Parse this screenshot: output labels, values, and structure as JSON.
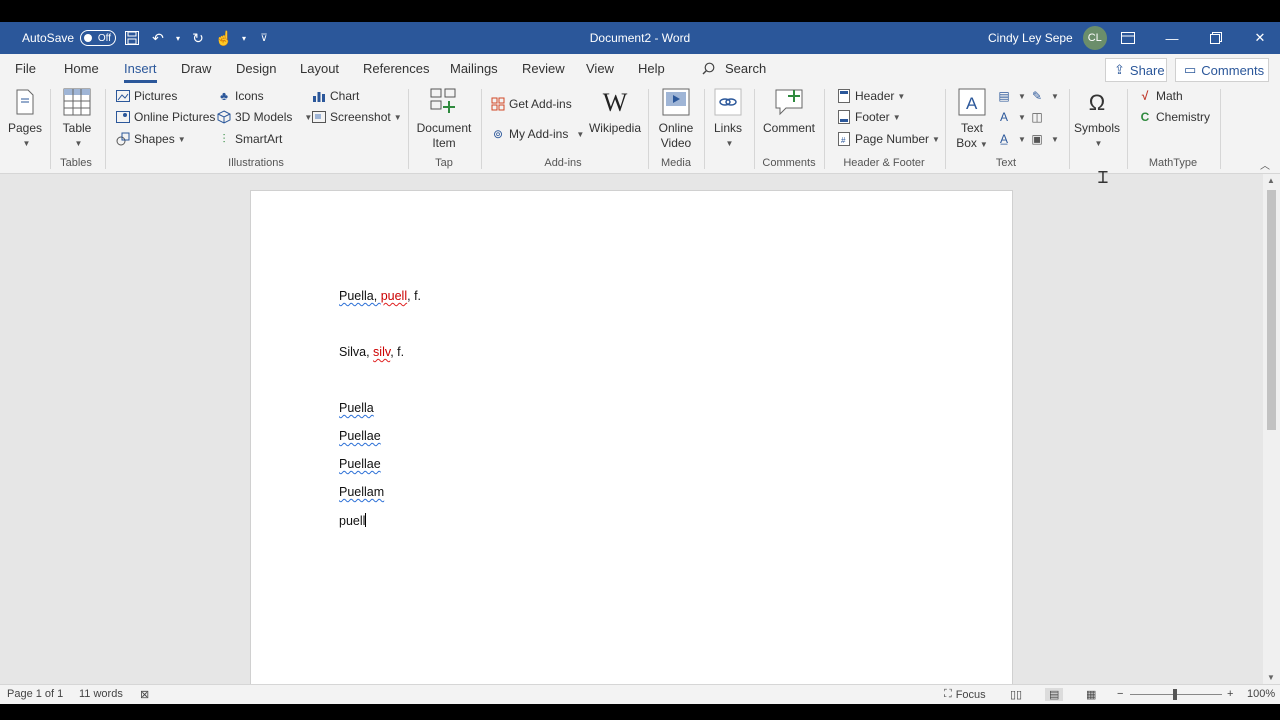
{
  "titlebar": {
    "autosave_label": "AutoSave",
    "autosave_state": "Off",
    "doc_title": "Document2  -  Word",
    "user_name": "Cindy Ley Sepe",
    "user_initials": "CL"
  },
  "tabs": [
    "File",
    "Home",
    "Insert",
    "Draw",
    "Design",
    "Layout",
    "References",
    "Mailings",
    "Review",
    "View",
    "Help"
  ],
  "active_tab": "Insert",
  "search_label": "Search",
  "share_label": "Share",
  "comments_label": "Comments",
  "ribbon": {
    "pages": "Pages",
    "table": "Table",
    "tables_group": "Tables",
    "pictures": "Pictures",
    "online_pictures": "Online Pictures",
    "shapes": "Shapes",
    "icons": "Icons",
    "models_3d": "3D Models",
    "smartart": "SmartArt",
    "chart": "Chart",
    "screenshot": "Screenshot",
    "illustrations_group": "Illustrations",
    "document_item_1": "Document",
    "document_item_2": "Item",
    "tap_group": "Tap",
    "get_addins": "Get Add-ins",
    "my_addins": "My Add-ins",
    "wikipedia": "Wikipedia",
    "addins_group": "Add-ins",
    "online_video_1": "Online",
    "online_video_2": "Video",
    "media_group": "Media",
    "links": "Links",
    "comment": "Comment",
    "comments_group": "Comments",
    "header": "Header",
    "footer": "Footer",
    "page_number": "Page Number",
    "header_footer_group": "Header & Footer",
    "text_box_1": "Text",
    "text_box_2": "Box",
    "text_group": "Text",
    "symbols": "Symbols",
    "math": "Math",
    "chemistry": "Chemistry",
    "mathtype_group": "MathType"
  },
  "document": {
    "line1_a": "Puella, ",
    "line1_b": "puell",
    "line1_c": ", f.",
    "line2_a": "Silva, ",
    "line2_b": "silv",
    "line2_c": ", f.",
    "list": [
      "Puella",
      "Puellae",
      "Puellae",
      "Puellam"
    ],
    "current_line": "puell"
  },
  "status": {
    "page": "Page 1 of 1",
    "words": "11 words",
    "focus": "Focus",
    "zoom": "100%"
  },
  "colors": {
    "brand": "#2b579a",
    "spell_error": "#e02020",
    "grammar": "#2b6fd6"
  }
}
